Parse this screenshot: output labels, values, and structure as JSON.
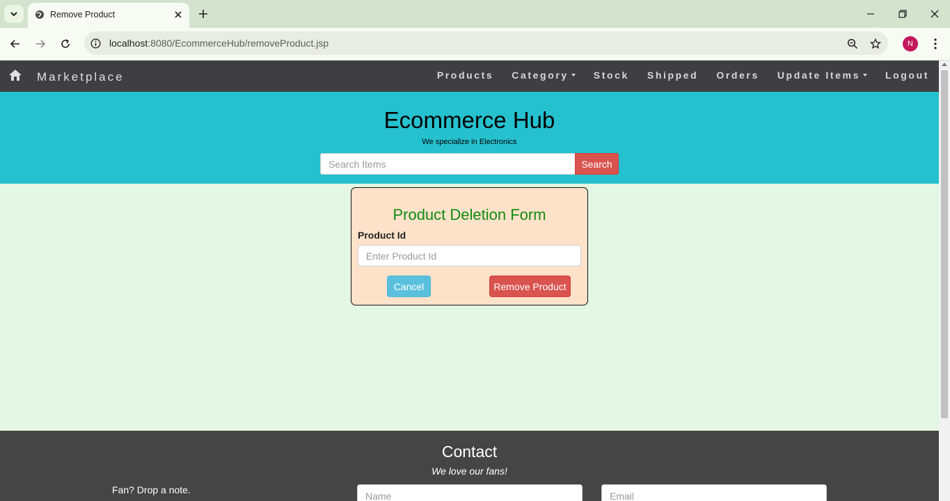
{
  "browser": {
    "tab_title": "Remove Product",
    "url_host": "localhost",
    "url_rest": ":8080/EcommerceHub/removeProduct.jsp",
    "profile_initial": "N"
  },
  "navbar": {
    "brand": "Marketplace",
    "items": [
      {
        "label": "Products",
        "dropdown": false
      },
      {
        "label": "Category",
        "dropdown": true
      },
      {
        "label": "Stock",
        "dropdown": false
      },
      {
        "label": "Shipped",
        "dropdown": false
      },
      {
        "label": "Orders",
        "dropdown": false
      },
      {
        "label": "Update Items",
        "dropdown": true
      },
      {
        "label": "Logout",
        "dropdown": false
      }
    ]
  },
  "header": {
    "title": "Ecommerce Hub",
    "tagline": "We specialize in Electronics",
    "search_placeholder": "Search Items",
    "search_button": "Search"
  },
  "form": {
    "title": "Product Deletion Form",
    "field_label": "Product Id",
    "field_placeholder": "Enter Product Id",
    "cancel_label": "Cancel",
    "submit_label": "Remove Product"
  },
  "footer": {
    "title": "Contact",
    "subtitle": "We love our fans!",
    "note": "Fan? Drop a note.",
    "name_placeholder": "Name",
    "email_placeholder": "Email"
  },
  "colors": {
    "navbar_bg": "#3f3f42",
    "header_bg": "#26c1cf",
    "page_bg": "#e4f7e4",
    "form_bg": "#ffe2c9",
    "form_title": "#0f8a0f",
    "danger": "#d9534f",
    "info": "#5bc0de",
    "footer_bg": "#454545"
  }
}
